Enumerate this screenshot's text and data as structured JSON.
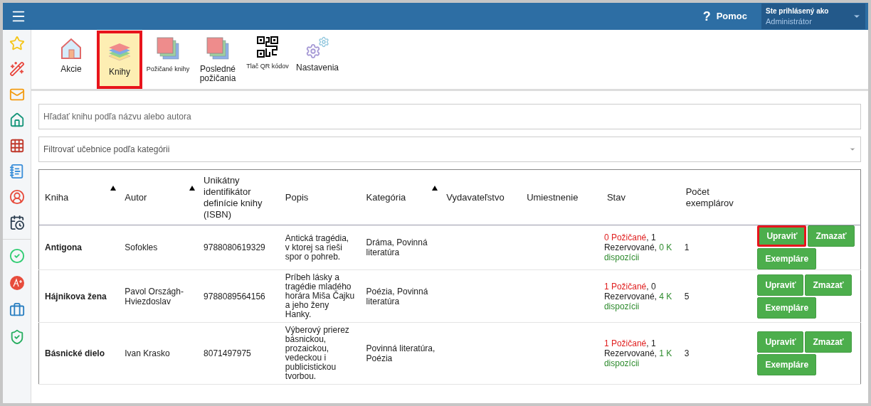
{
  "header": {
    "help_icon": "?",
    "help": "Pomoc",
    "user_label": "Ste prihlásený ako",
    "user_name": "Administrátor"
  },
  "toolbar": [
    {
      "kind": "house",
      "label": "Akcie",
      "selected": false,
      "highlighted": false,
      "small": false
    },
    {
      "kind": "layers",
      "label": "Knihy",
      "selected": true,
      "highlighted": true,
      "small": false
    },
    {
      "kind": "stack",
      "label": "Požičané knihy",
      "selected": false,
      "highlighted": false,
      "small": true
    },
    {
      "kind": "stack",
      "label": "Posledné požičania",
      "selected": false,
      "highlighted": false,
      "small": false
    },
    {
      "kind": "qr",
      "label": "Tlač QR kódov",
      "selected": false,
      "highlighted": false,
      "small": true
    },
    {
      "kind": "gears",
      "label": "Nastavenia",
      "selected": false,
      "highlighted": false,
      "small": false
    }
  ],
  "search": {
    "placeholder": "Hľadať knihu podľa názvu alebo autora"
  },
  "filter": {
    "placeholder": "Filtrovať učebnice podľa kategórii"
  },
  "table": {
    "columns": [
      {
        "label": "Kniha",
        "sortable": true
      },
      {
        "label": "Autor",
        "sortable": true
      },
      {
        "label": "Unikátny identifikátor definície knihy (ISBN)",
        "sortable": false
      },
      {
        "label": "Popis",
        "sortable": false
      },
      {
        "label": "Kategória",
        "sortable": true
      },
      {
        "label": "Vydavateľstvo",
        "sortable": false
      },
      {
        "label": "Umiestnenie",
        "sortable": false
      },
      {
        "label": "Stav",
        "sortable": false
      },
      {
        "label": "Počet exemplárov",
        "sortable": false
      }
    ],
    "rows": [
      {
        "title": "Antigona",
        "author": "Sofokles",
        "isbn": "9788080619329",
        "description": "Antická tragédia, v ktorej sa rieši spor o pohreb.",
        "category": "Dráma, Povinná literatúra",
        "status": [
          {
            "kind": "borrowed",
            "text": "0 Požičané"
          },
          {
            "kind": "plain",
            "text": ", 1 Rezervované, "
          },
          {
            "kind": "available",
            "text": "0 K dispozícii"
          }
        ],
        "copies": "1",
        "actions": [
          {
            "label": "Upraviť",
            "highlighted": true
          },
          {
            "label": "Zmazať",
            "highlighted": false
          },
          {
            "label": "Exempláre",
            "highlighted": false
          }
        ]
      },
      {
        "title": "Hájnikova žena",
        "author": "Pavol Országh-Hviezdoslav",
        "isbn": "9788089564156",
        "description": "Príbeh lásky a tragédie mladého horára Miša Čajku a jeho ženy Hanky.",
        "category": "Poézia, Povinná literatúra",
        "status": [
          {
            "kind": "borrowed",
            "text": "1 Požičané"
          },
          {
            "kind": "plain",
            "text": ", 0 Rezervované, "
          },
          {
            "kind": "available",
            "text": "4 K dispozícii"
          }
        ],
        "copies": "5",
        "actions": [
          {
            "label": "Upraviť",
            "highlighted": false
          },
          {
            "label": "Zmazať",
            "highlighted": false
          },
          {
            "label": "Exempláre",
            "highlighted": false
          }
        ]
      },
      {
        "title": "Básnické dielo",
        "author": "Ivan Krasko",
        "isbn": "8071497975",
        "description": "Výberový prierez básnickou, prozaickou, vedeckou i publicistickou tvorbou.",
        "category": "Povinná literatúra, Poézia",
        "status": [
          {
            "kind": "borrowed",
            "text": "1 Požičané"
          },
          {
            "kind": "plain",
            "text": ", 1 Rezervované, "
          },
          {
            "kind": "available",
            "text": "1 K dispozícii"
          }
        ],
        "copies": "3",
        "actions": [
          {
            "label": "Upraviť",
            "highlighted": false
          },
          {
            "label": "Zmazať",
            "highlighted": false
          },
          {
            "label": "Exempláre",
            "highlighted": false
          }
        ]
      }
    ]
  }
}
